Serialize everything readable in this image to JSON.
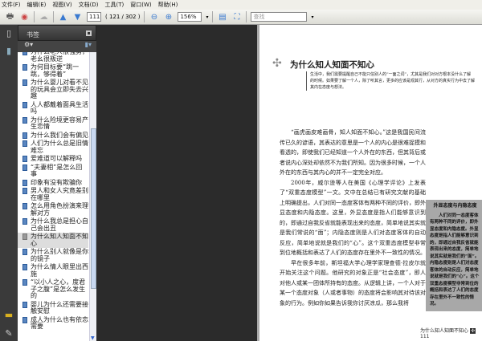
{
  "menu": [
    "文件(F)",
    "编辑(E)",
    "视图(V)",
    "文档(D)",
    "工具(T)",
    "窗口(W)",
    "帮助(H)"
  ],
  "toolbar": {
    "page_input": "111",
    "page_of": "( 121 / 302 )",
    "zoom": "156%",
    "search_placeholder": "查找"
  },
  "panel": {
    "title": "书签"
  },
  "bookmarks": [
    {
      "label": "为什么老人很强势，老幺很叛逆"
    },
    {
      "label": "为何目标要“跳一跳，够得着”"
    },
    {
      "label": "为什么婴儿对看不见的玩具会立即失去兴趣"
    },
    {
      "label": "人人都戴着面具生活吗"
    },
    {
      "label": "为什么险境更容易产生恋情"
    },
    {
      "label": "为什么我们会有偏见"
    },
    {
      "label": "人们为什么总是旧情难忘"
    },
    {
      "label": "爱难道可以解释吗"
    },
    {
      "label": "“夫妻相”是怎么回事"
    },
    {
      "label": "印象有没有欺骗你"
    },
    {
      "label": "男人和女人究竟差别在哪里"
    },
    {
      "label": "怎么用角色扮演来理解对方"
    },
    {
      "label": "为什么我总是担心自己会出丑"
    },
    {
      "label": "为什么知人知面不知心",
      "selected": true
    },
    {
      "label": "为什么别人就像是你的镜子"
    },
    {
      "label": "为什么情人眼里出西施"
    },
    {
      "label": "“以小人之心，度君子之腹”是怎么发生的"
    },
    {
      "label": "婴儿为什么还需要接触安慰"
    },
    {
      "label": "成人为什么也有依恋需要"
    }
  ],
  "page": {
    "title": "为什么知人知面不知心",
    "intro": "生活中，我们需要提醒自己不能只信别人的“一面之词”，尤其是我们对对方根本没什么了解的时候。如果要了解一个人，除了听其言，更多的应该是观其行，从对方的真实行为中去了解其内在态度与想法。",
    "paragraphs": [
      "“画虎画皮难画骨，知人知面不知心。”这是我国民间流传已久的谚语，其表达的意思是一个人的内心是很难捉摸和看透的，即使我们已经知道一个人外在的东西，但其背后或者说内心深处却依然不为我们所知。因为很多时候，一个人外在的东西与其内心的并不一定完全对应。",
      "2000年，威尔逊等人在美国《心理学评论》上发表了“双重态度模型”一文。文中在总结已有研究文献的基础上明确提出，人们对同一态度客体有两种不同的评价，即外显态度和内隐态度。这里，外显态度是指人们能够意识到的，即通过自我反省就能表现出来的态度，简单地说其实就是我们常说的“面”；内隐态度则是人们对态度客体的自动反应，简单地说就是我们的“心”。这个双重态度模型非常到位地概括和表达了人们的态度存在里外不一致性的情况。",
      "早在很多年前，斯坦福大学心理学家理查德·拉皮尔就开始关注这个问题。他研究的对象正是“社会态度”，即人对他人或某一团体所持有的态度。从逻辑上讲，一个人对于某一个态度对象（人或者事物）的态度将会影响其对待该对象的行为。例如你如果告诉我你讨厌凉瓜，那么我将"
    ],
    "aside_title": "外显态度与内隐态度",
    "aside_text": "人们对同一态度客体有两种不同的评价，即外显态度和内隐态度。外显态度是指人们能够意识到的，即通过自我反省就能表现出来的态度，简单地说其实就是我们的“面”。内隐态度则是人们对态度客体的自动反应，简单地说就是我们的“心”。这个双重态度模型非常到位的概括和表达了人们的态度存在里外不一致性的情况。",
    "footer_title": "为什么知人知面不知心",
    "page_number": "111"
  }
}
